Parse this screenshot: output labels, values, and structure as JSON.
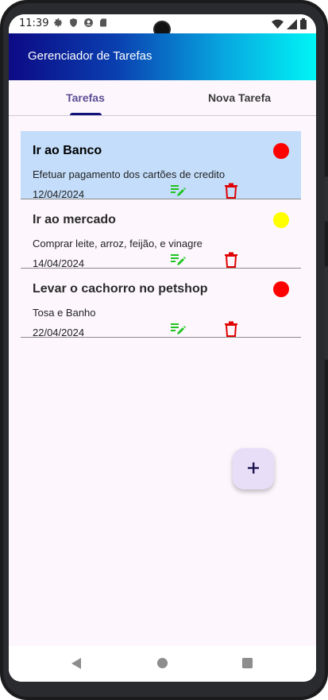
{
  "status_bar": {
    "time": "11:39"
  },
  "app_bar": {
    "title": "Gerenciador de Tarefas"
  },
  "tabs": [
    {
      "label": "Tarefas",
      "selected": true
    },
    {
      "label": "Nova Tarefa",
      "selected": false
    }
  ],
  "tasks": [
    {
      "title": "Ir ao Banco",
      "description": "Efetuar pagamento dos cartões de credito",
      "date": "12/04/2024",
      "priority_color": "#ff0000",
      "selected": true
    },
    {
      "title": "Ir ao mercado",
      "description": "Comprar leite, arroz, feijão, e vinagre",
      "date": "14/04/2024",
      "priority_color": "#ffff00",
      "selected": false
    },
    {
      "title": "Levar o cachorro no petshop",
      "description": "Tosa e Banho",
      "date": "22/04/2024",
      "priority_color": "#ff0000",
      "selected": false
    }
  ],
  "fab": {
    "icon": "plus-icon",
    "label": "+"
  },
  "colors": {
    "edit_icon": "#1fc51f",
    "delete_icon": "#e00000",
    "selected_row": "#c3ddfa",
    "accent": "#13127b"
  },
  "nav": {
    "back_icon": "back-icon",
    "home_icon": "home-icon",
    "recents_icon": "recents-icon"
  }
}
